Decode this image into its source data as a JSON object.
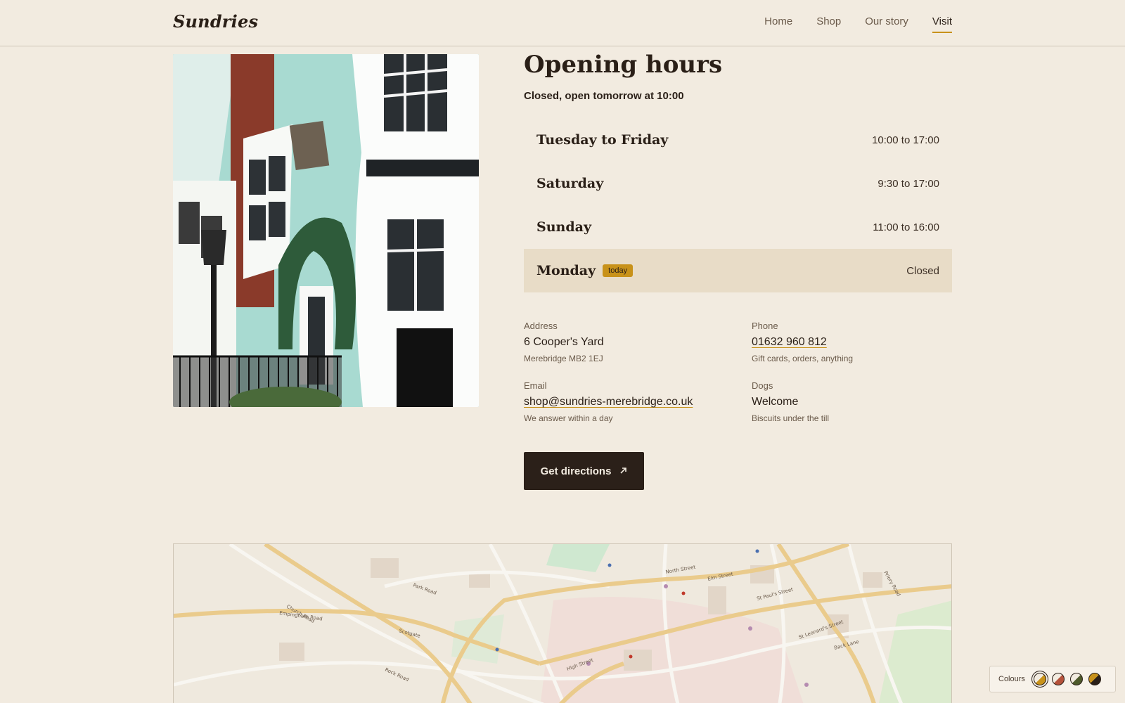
{
  "header": {
    "logo": "Sundries",
    "nav": [
      {
        "label": "Home",
        "active": false
      },
      {
        "label": "Shop",
        "active": false
      },
      {
        "label": "Our story",
        "active": false
      },
      {
        "label": "Visit",
        "active": true
      }
    ]
  },
  "hours": {
    "title": "Opening hours",
    "status": "Closed, open tomorrow at 10:00",
    "rows": [
      {
        "day": "Tuesday to Friday",
        "time": "10:00 to 17:00"
      },
      {
        "day": "Saturday",
        "time": "9:30 to 17:00"
      },
      {
        "day": "Sunday",
        "time": "11:00 to 16:00"
      },
      {
        "day": "Monday",
        "time": "Closed",
        "badge": "today"
      }
    ]
  },
  "contact": {
    "address": {
      "label": "Address",
      "value": "6 Cooper's Yard",
      "sub": "Merebridge MB2 1EJ"
    },
    "phone": {
      "label": "Phone",
      "value": "01632 960 812",
      "sub": "Gift cards, orders, anything"
    },
    "email": {
      "label": "Email",
      "value": "shop@sundries-merebridge.co.uk",
      "sub": "We answer within a day"
    },
    "dogs": {
      "label": "Dogs",
      "value": "Welcome",
      "sub": "Biscuits under the till"
    }
  },
  "directions_button": {
    "label": "Get directions",
    "icon": "arrow-up-right-icon"
  },
  "map": {
    "street_labels": [
      "North Street",
      "Elm Street",
      "Church Road",
      "Scotgate",
      "Park Road",
      "St Paul's Street",
      "High Street",
      "Rock Road",
      "Priory Road",
      "Back Lane",
      "St Leonard's Street",
      "Empingham Road"
    ]
  },
  "colour_switcher": {
    "label": "Colours",
    "swatches": [
      {
        "a": "#f2ebe0",
        "b": "#c8921a",
        "active": true
      },
      {
        "a": "#f2ebe0",
        "b": "#b5523b",
        "active": false
      },
      {
        "a": "#f2ebe0",
        "b": "#4e5a2c",
        "active": false
      },
      {
        "a": "#c8921a",
        "b": "#2a1f17",
        "active": false
      }
    ]
  }
}
